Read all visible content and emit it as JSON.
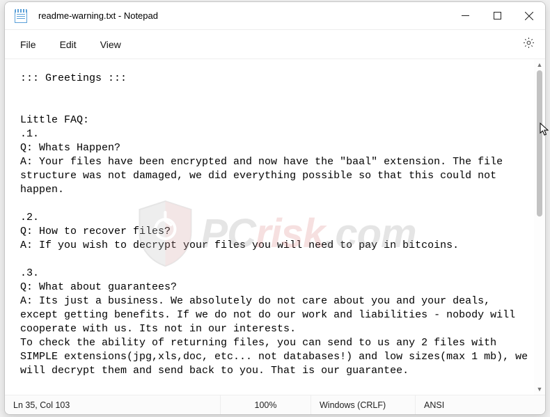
{
  "window": {
    "title": "readme-warning.txt - Notepad"
  },
  "menubar": {
    "file": "File",
    "edit": "Edit",
    "view": "View"
  },
  "document": {
    "text": "::: Greetings :::\n\n\nLittle FAQ:\n.1.\nQ: Whats Happen?\nA: Your files have been encrypted and now have the \"baal\" extension. The file structure was not damaged, we did everything possible so that this could not happen.\n\n.2.\nQ: How to recover files?\nA: If you wish to decrypt your files you will need to pay in bitcoins.\n\n.3.\nQ: What about guarantees?\nA: Its just a business. We absolutely do not care about you and your deals, except getting benefits. If we do not do our work and liabilities - nobody will cooperate with us. Its not in our interests.\nTo check the ability of returning files, you can send to us any 2 files with SIMPLE extensions(jpg,xls,doc, etc... not databases!) and low sizes(max 1 mb), we will decrypt them and send back to you. That is our guarantee."
  },
  "statusbar": {
    "position": "Ln 35, Col 103",
    "zoom": "100%",
    "line_ending": "Windows (CRLF)",
    "encoding": "ANSI"
  },
  "watermark": {
    "text_pc": "PC",
    "text_risk": "risk",
    "text_com": ".com"
  }
}
